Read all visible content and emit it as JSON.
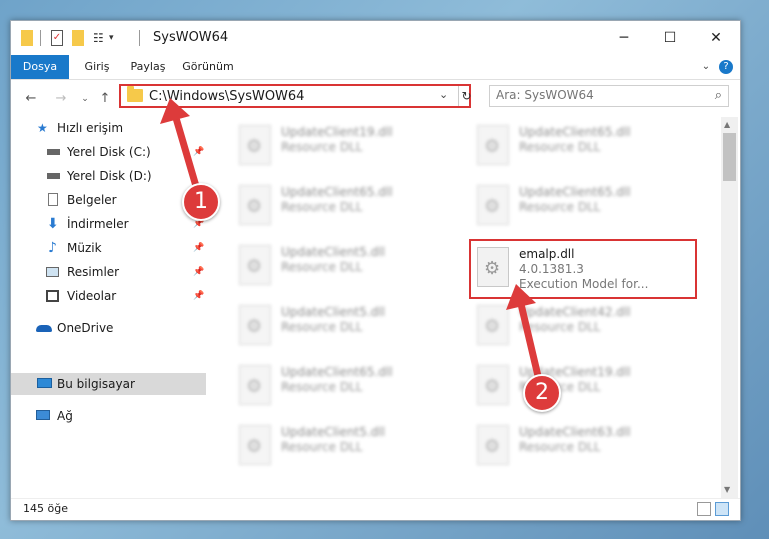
{
  "window": {
    "title": "SysWOW64"
  },
  "ribbon": {
    "tabs": [
      "Dosya",
      "Giriş",
      "Paylaş",
      "Görünüm"
    ]
  },
  "address": {
    "path": "C:\\Windows\\SysWOW64"
  },
  "search": {
    "placeholder": "Ara: SysWOW64"
  },
  "nav": {
    "items": [
      {
        "label": "Hızlı erişim",
        "icon": "star-icon"
      },
      {
        "label": "Yerel Disk (C:)",
        "icon": "drive-icon",
        "pinned": true
      },
      {
        "label": "Yerel Disk (D:)",
        "icon": "drive-icon",
        "pinned": false
      },
      {
        "label": "Belgeler",
        "icon": "document-icon",
        "pinned": true
      },
      {
        "label": "İndirmeler",
        "icon": "download-icon",
        "pinned": true
      },
      {
        "label": "Müzik",
        "icon": "music-icon",
        "pinned": true
      },
      {
        "label": "Resimler",
        "icon": "pictures-icon",
        "pinned": true
      },
      {
        "label": "Videolar",
        "icon": "video-icon",
        "pinned": true
      },
      {
        "label": "OneDrive",
        "icon": "cloud-icon"
      },
      {
        "label": "Bu bilgisayar",
        "icon": "computer-icon",
        "selected": true
      },
      {
        "label": "Ağ",
        "icon": "network-icon"
      }
    ]
  },
  "files": [
    {
      "name": "UpdateClient19.dll",
      "type": "Resource DLL"
    },
    {
      "name": "UpdateClient65.dll",
      "type": "Resource DLL"
    },
    {
      "name": "UpdateClient65.dll",
      "type": "Resource DLL"
    },
    {
      "name": "UpdateClient65.dll",
      "type": "Resource DLL"
    },
    {
      "name": "UpdateClient5.dll",
      "type": "Resource DLL"
    },
    {
      "name": "emalp.dll",
      "version": "4.0.1381.3",
      "type": "Execution Model for...",
      "highlighted": true
    },
    {
      "name": "UpdateClient5.dll",
      "type": "Resource DLL"
    },
    {
      "name": "UpdateClient42.dll",
      "type": "Resource DLL"
    },
    {
      "name": "UpdateClient65.dll",
      "type": "Resource DLL"
    },
    {
      "name": "UpdateClient19.dll",
      "type": "Resource DLL"
    },
    {
      "name": "UpdateClient5.dll",
      "type": "Resource DLL"
    },
    {
      "name": "UpdateClient63.dll",
      "type": "Resource DLL"
    }
  ],
  "status": {
    "count": "145 öğe"
  },
  "annotations": {
    "step1": "1",
    "step2": "2",
    "color": "#dd3b3b"
  }
}
